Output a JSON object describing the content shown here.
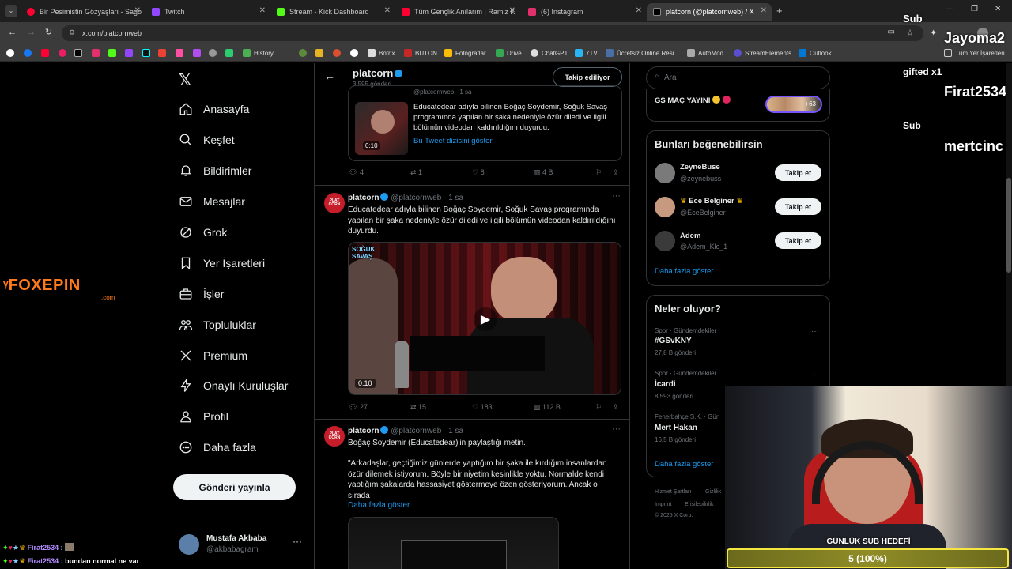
{
  "browser": {
    "tabs": [
      {
        "title": "Bir Pesimistin Gözyaşları - Sago",
        "color": "#ff0033"
      },
      {
        "title": "Twitch",
        "color": "#9146ff"
      },
      {
        "title": "Stream - Kick Dashboard",
        "color": "#53fc18"
      },
      {
        "title": "Tüm Gençlik Anılarım | Ramiz K",
        "color": "#ff0033"
      },
      {
        "title": "(6) Instagram",
        "color": "#e1306c"
      },
      {
        "title": "platcorn (@platcornweb) / X",
        "color": "#ffffff"
      }
    ],
    "url": "x.com/platcornweb",
    "bookmarks": [
      {
        "label": "History"
      },
      {
        "label": "Botrix"
      },
      {
        "label": "BUTON"
      },
      {
        "label": "Fotoğraflar"
      },
      {
        "label": "Drive"
      },
      {
        "label": "ChatGPT"
      },
      {
        "label": "7TV"
      },
      {
        "label": "Ücretsiz Online Resi..."
      },
      {
        "label": "AutoMod"
      },
      {
        "label": "StreamElements"
      },
      {
        "label": "Outlook"
      },
      {
        "label": "Tüm Yer İşaretleri"
      }
    ]
  },
  "nav": {
    "items": [
      "Anasayfa",
      "Keşfet",
      "Bildirimler",
      "Mesajlar",
      "Grok",
      "Yer İşaretleri",
      "İşler",
      "Topluluklar",
      "Premium",
      "Onaylı Kuruluşlar",
      "Profil",
      "Daha fazla"
    ],
    "post_button": "Gönderi yayınla",
    "account": {
      "name": "Mustafa Akbaba",
      "handle": "@akbabagram"
    }
  },
  "header": {
    "name": "platcorn",
    "posts": "3.595 gönderi",
    "follow_state": "Takip ediliyor"
  },
  "tweets": {
    "quoted": {
      "handle": "@platcornweb",
      "time": "1 sa",
      "text": "Educatedear adıyla bilinen Boğaç Soydemir, Soğuk Savaş programında yapılan bir şaka nedeniyle özür diledi ve ilgili bölümün videodan kaldırıldığını duyurdu.",
      "link": "Bu Tweet dizisini göster",
      "duration": "0:10",
      "replies": "4",
      "reposts": "1",
      "likes": "8",
      "views": "4 B"
    },
    "main": {
      "name": "platcorn",
      "handle": "@platcornweb",
      "time": "1 sa",
      "text": "Educatedear adıyla bilinen Boğaç Soydemir, Soğuk Savaş programında yapılan bir şaka nedeniyle özür diledi ve ilgili bölümün videodan kaldırıldığını duyurdu.",
      "video_badge": "SOĞUK SAVAŞ",
      "duration": "0:10",
      "replies": "27",
      "reposts": "15",
      "likes": "183",
      "views": "112 B"
    },
    "third": {
      "name": "platcorn",
      "handle": "@platcornweb",
      "time": "1 sa",
      "text1": "Boğaç Soydemir (Educatedear)'in paylaştığı metin.",
      "text2": "\"Arkadaşlar, geçtiğimiz günlerde yaptığım bir şaka ile kırdığım insanlardan özür dilemek istiyorum. Böyle bir niyetim kesinlikle yoktu. Normalde kendi yaptığım şakalarda hassasiyet göstermeye özen gösteriyorum. Ancak o sırada",
      "more": "Daha fazla göster"
    },
    "avatar_label": "PLAT CORN"
  },
  "right": {
    "search_placeholder": "Ara",
    "live": {
      "title": "GS MAÇ YAYINI",
      "count": "+63"
    },
    "suggest_title": "Bunları beğenebilirsin",
    "suggestions": [
      {
        "name": "ZeyneBuse",
        "handle": "@zeynebuss"
      },
      {
        "name": "Ece Belginer",
        "handle": "@EceBelginer"
      },
      {
        "name": "Adem",
        "handle": "@Adem_Klc_1"
      }
    ],
    "follow_label": "Takip et",
    "show_more": "Daha fazla göster",
    "trends_title": "Neler oluyor?",
    "trends": [
      {
        "meta": "Spor · Gündemdekiler",
        "name": "#GSvKNY",
        "count": "27,8 B gönderi"
      },
      {
        "meta": "Spor · Gündemdekiler",
        "name": "İcardi",
        "count": "8.593 gönderi"
      },
      {
        "meta": "Fenerbahçe S.K. · Gün",
        "name": "Mert Hakan",
        "count": "16,5 B gönderi"
      }
    ],
    "trends_more": "Daha fazla göster",
    "footer": [
      "Hizmet Şartları",
      "Gizlilik",
      "Imprint",
      "Erişilebilirlik",
      "© 2025 X Corp."
    ]
  },
  "overlays": {
    "logo": "FOXEPIN",
    "logo_sub": ".com",
    "alerts": [
      {
        "text": "Sub"
      },
      {
        "text": "Jayoma2"
      },
      {
        "text": "gifted x1"
      },
      {
        "text": "Firat2534"
      },
      {
        "text": "Sub"
      },
      {
        "text": "mertcinc"
      }
    ],
    "chat": [
      {
        "user": "Firat2534",
        "msg": ""
      },
      {
        "user": "Firat2534",
        "msg": "bundan normal ne var"
      }
    ],
    "goal": {
      "title": "GÜNLÜK SUB HEDEFİ",
      "value": "5 (100%)",
      "progress": 1.0
    }
  }
}
